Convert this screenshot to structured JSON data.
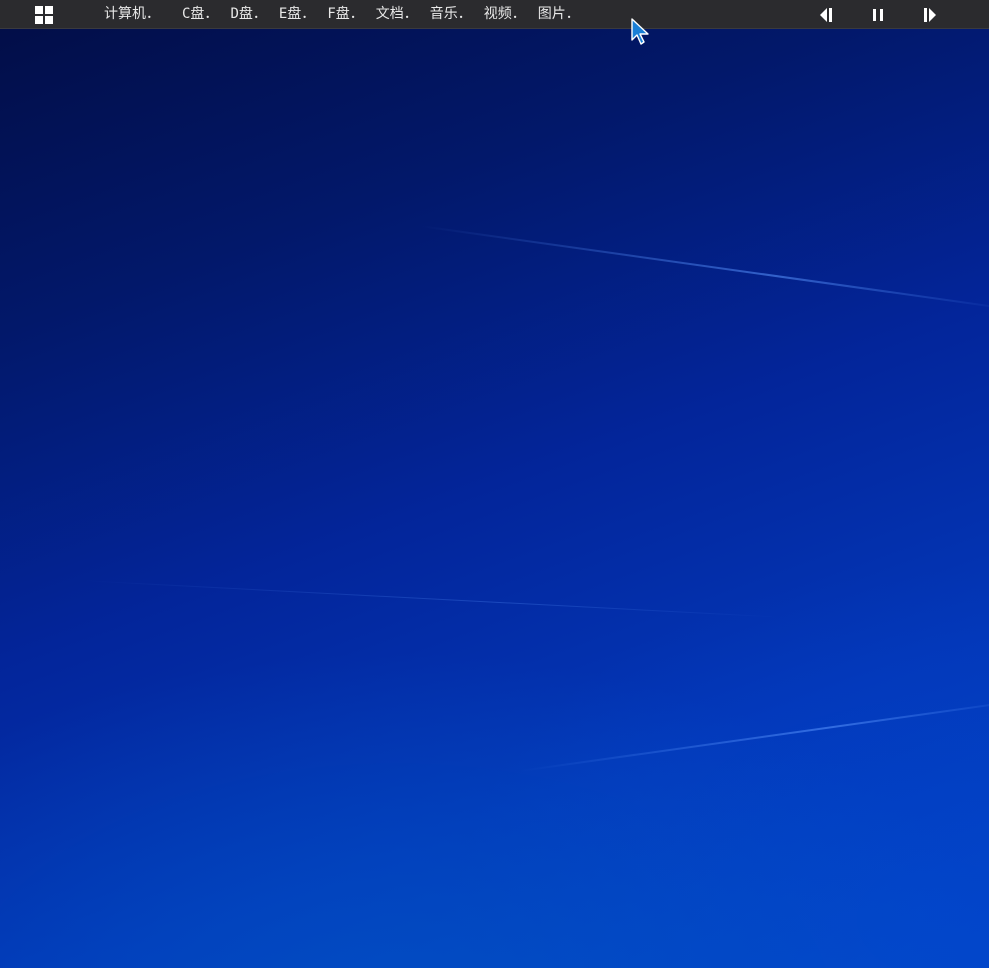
{
  "taskbar": {
    "menu_items": [
      {
        "label": "计算机．"
      },
      {
        "label": "C盘．"
      },
      {
        "label": "D盘．"
      },
      {
        "label": "E盘．"
      },
      {
        "label": "F盘．"
      },
      {
        "label": "文档．"
      },
      {
        "label": "音乐．"
      },
      {
        "label": "视频．"
      },
      {
        "label": "图片．"
      }
    ],
    "controls": {
      "previous_icon": "step-backward-icon",
      "pause_icon": "pause-icon",
      "next_icon": "step-forward-icon"
    },
    "start_icon": "windows-grid-icon"
  },
  "colors": {
    "taskbar_bg": "#2b2b2e",
    "taskbar_text": "#e8e8e8",
    "desktop_top": "#020d45",
    "desktop_bottom": "#0446c6"
  }
}
